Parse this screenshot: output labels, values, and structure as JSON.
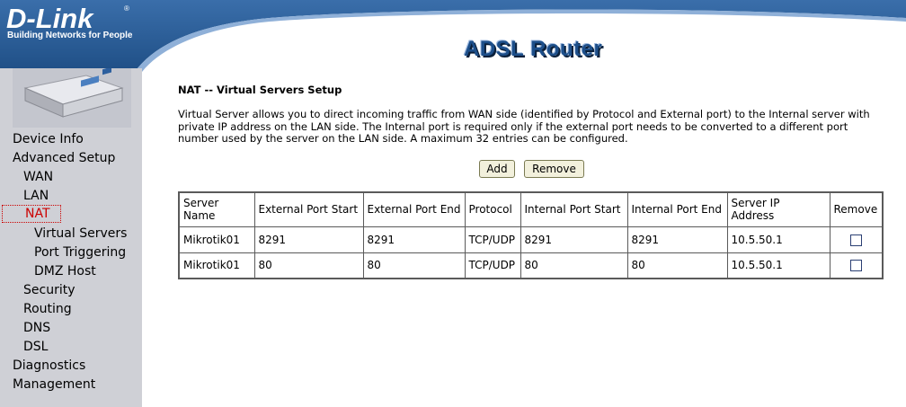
{
  "header": {
    "logo": "D-Link",
    "logo_reg": "®",
    "tagline": "Building Networks for People",
    "title": "ADSL Router",
    "colors": {
      "banner": "#2a5f9c",
      "sidebar": "#cfd0d6"
    }
  },
  "sidebar": {
    "device_image": "router-device-image",
    "items": [
      {
        "label": "Device Info"
      },
      {
        "label": "Advanced Setup"
      },
      {
        "label": "WAN"
      },
      {
        "label": "LAN"
      },
      {
        "label": "NAT"
      },
      {
        "label": "Virtual Servers"
      },
      {
        "label": "Port Triggering"
      },
      {
        "label": "DMZ Host"
      },
      {
        "label": "Security"
      },
      {
        "label": "Routing"
      },
      {
        "label": "DNS"
      },
      {
        "label": "DSL"
      },
      {
        "label": "Diagnostics"
      },
      {
        "label": "Management"
      }
    ]
  },
  "main": {
    "heading": "NAT -- Virtual Servers Setup",
    "description": "Virtual Server allows you to direct incoming traffic from WAN side (identified by Protocol and External port) to the Internal server with private IP address on the LAN side. The Internal port is required only if the external port needs to be converted to a different port number used by the server on the LAN side. A maximum 32 entries can be configured.",
    "buttons": {
      "add": "Add",
      "remove": "Remove"
    },
    "table": {
      "headers": [
        "Server Name",
        "External Port Start",
        "External Port End",
        "Protocol",
        "Internal Port Start",
        "Internal Port End",
        "Server IP Address",
        "Remove"
      ],
      "rows": [
        [
          "Mikrotik01",
          "8291",
          "8291",
          "TCP/UDP",
          "8291",
          "8291",
          "10.5.50.1"
        ],
        [
          "Mikrotik01",
          "80",
          "80",
          "TCP/UDP",
          "80",
          "80",
          "10.5.50.1"
        ]
      ]
    }
  }
}
